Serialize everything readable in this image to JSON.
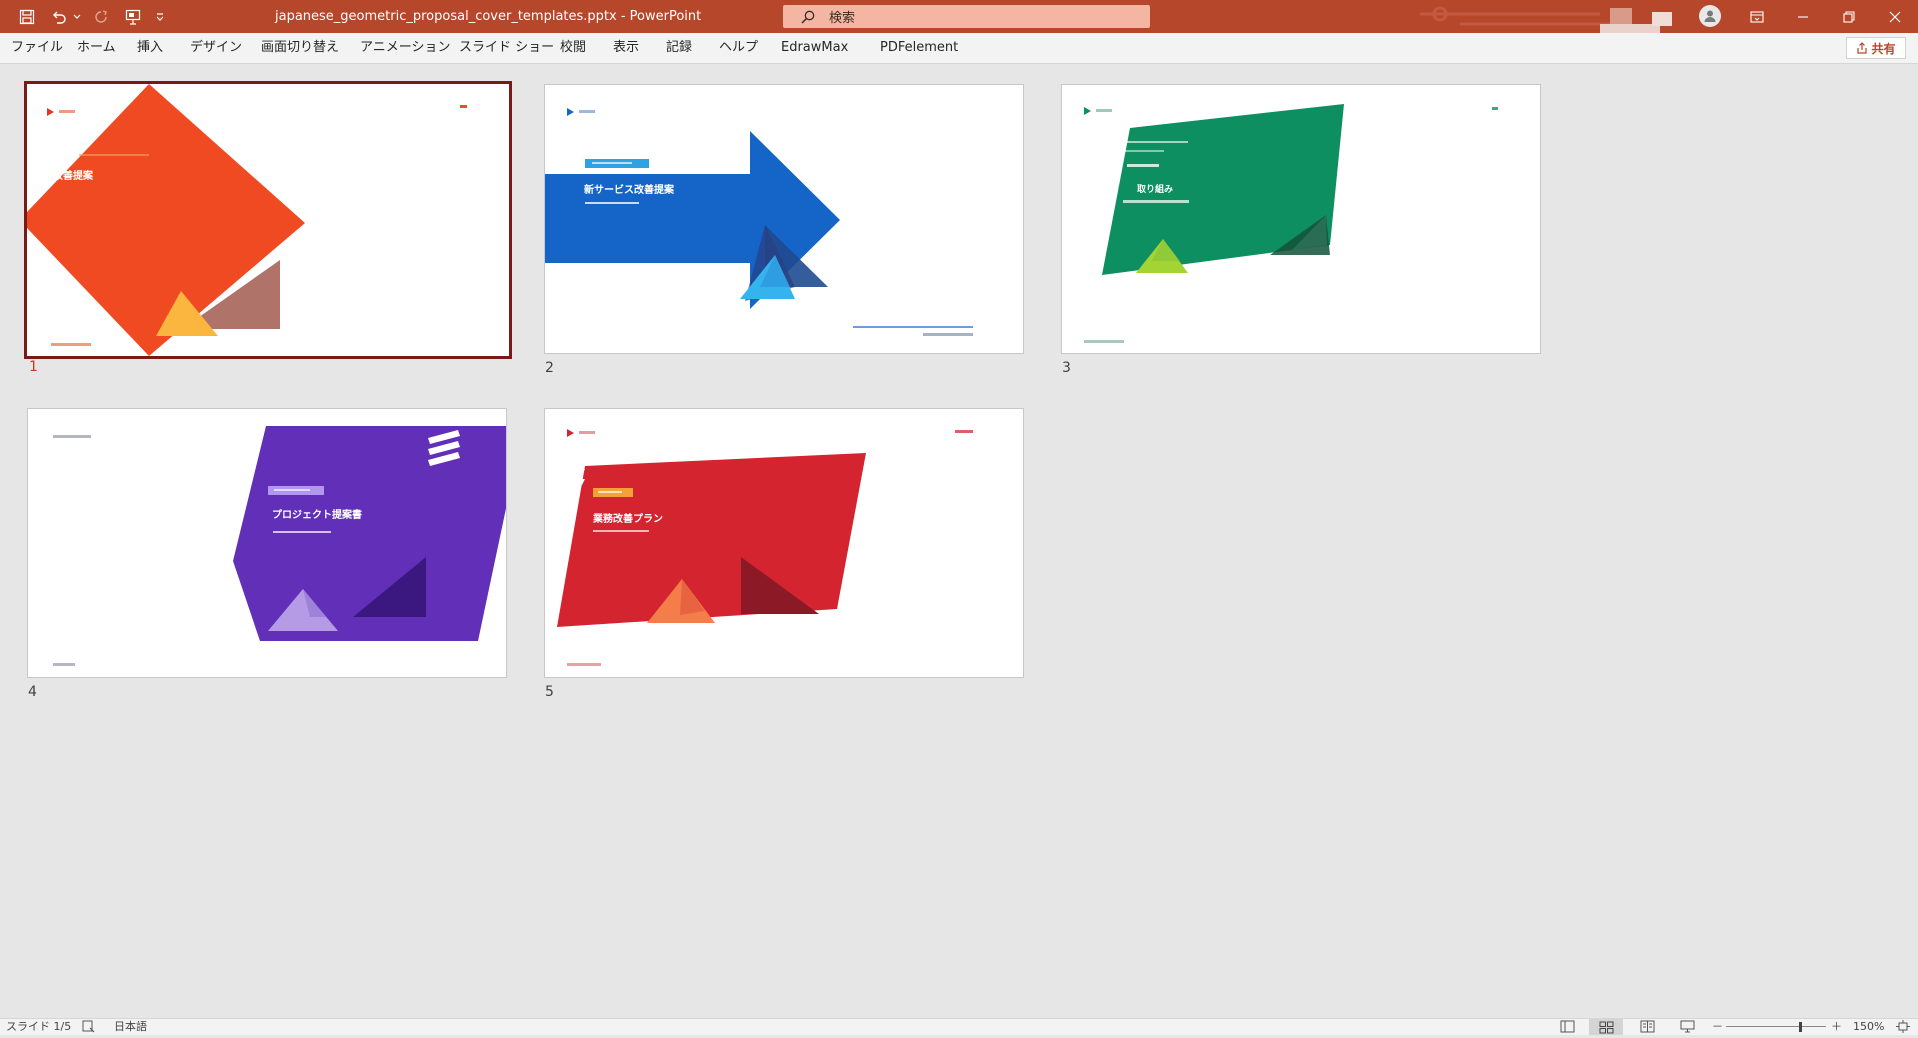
{
  "window": {
    "doc_title": "japanese_geometric_proposal_cover_templates.pptx  -  PowerPoint",
    "search_placeholder": "検索"
  },
  "ribbon": {
    "tabs": [
      "ファイル",
      "ホーム",
      "挿入",
      "デザイン",
      "画面切り替え",
      "アニメーション",
      "スライド ショー",
      "校閲",
      "表示",
      "記録",
      "ヘルプ",
      "EdrawMax",
      "PDFelement"
    ],
    "share_label": "共有"
  },
  "slides": [
    {
      "number": "1",
      "title": "改善提案",
      "selected": true,
      "accent": "#f04a23"
    },
    {
      "number": "2",
      "title": "新サービス改善提案",
      "selected": false,
      "accent": "#1565c8"
    },
    {
      "number": "3",
      "title": "取り組み",
      "selected": false,
      "accent": "#0d8f62"
    },
    {
      "number": "4",
      "title": "プロジェクト提案書",
      "selected": false,
      "accent": "#6230b8"
    },
    {
      "number": "5",
      "title": "業務改善プラン",
      "selected": false,
      "accent": "#d32430"
    }
  ],
  "status": {
    "slide_info": "スライド 1/5",
    "language": "日本語",
    "zoom": "150%",
    "zoom_minus": "－",
    "zoom_plus": "＋"
  }
}
